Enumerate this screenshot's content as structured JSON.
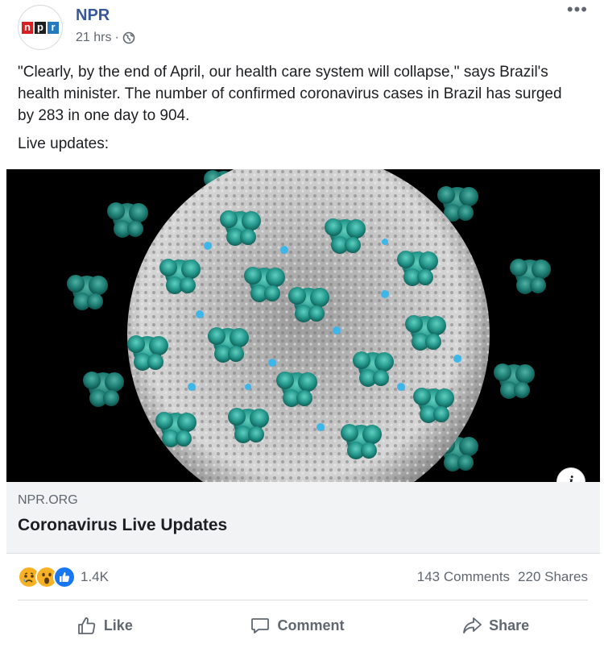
{
  "page": {
    "name": "NPR",
    "time": "21 hrs",
    "separator": "·",
    "audience_icon": "globe-icon",
    "more_label": "•••"
  },
  "logo": {
    "letters": [
      "n",
      "p",
      "r"
    ]
  },
  "post": {
    "text": "\"Clearly, by the end of April, our health care system will collapse,\" says Brazil's health minister. The number of confirmed coronavirus cases in Brazil has surged by 283 in one day to 904.",
    "subtext": "Live updates:"
  },
  "link_preview": {
    "domain": "NPR.ORG",
    "title": "Coronavirus Live Updates",
    "info_label": "i"
  },
  "engagement": {
    "reaction_icons": [
      "sad-reaction-icon",
      "wow-reaction-icon",
      "like-reaction-icon"
    ],
    "reaction_count": "1.4K",
    "comments": "143 Comments",
    "shares": "220 Shares"
  },
  "actions": {
    "like": "Like",
    "comment": "Comment",
    "share": "Share"
  },
  "colors": {
    "link_blue": "#385898",
    "meta_gray": "#606770",
    "like_blue": "#1877f2",
    "virus_teal": "#2a9d8f",
    "npr_red": "#d62021",
    "npr_blue": "#237bbd"
  }
}
